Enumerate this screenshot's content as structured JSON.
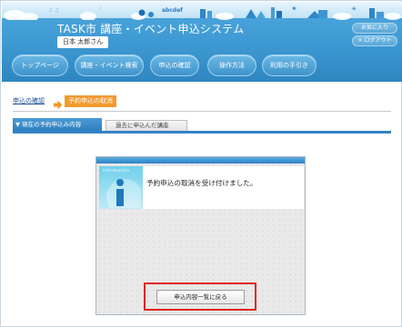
{
  "header": {
    "app_title": "TASK市 講座・イベント申込システム",
    "user_name": "日本 太郎さん",
    "deco_letters": "abcdef",
    "links": {
      "favorites": "お気に入り",
      "logout": "× ログアウト"
    }
  },
  "nav": {
    "items": [
      {
        "label": "トップページ"
      },
      {
        "label": "講座・イベント検索"
      },
      {
        "label": "申込の確認"
      },
      {
        "label": "操作方法"
      },
      {
        "label": "利用の手引き"
      }
    ]
  },
  "breadcrumb": {
    "link": "申込の確認",
    "current": "予約申込の取消"
  },
  "tabs": {
    "current": "▼ 現在の予約申込み内容",
    "past": "過去に申込んだ講座"
  },
  "dialog": {
    "info_label": "Information",
    "message": "予約申込の取消を受け付けました。",
    "return_button": "申込内容一覧に戻る"
  },
  "colors": {
    "header_blue": "#3d98d2",
    "accent_orange": "#f29a2e",
    "tab_blue": "#3583c3",
    "highlight_red": "#e02121"
  }
}
